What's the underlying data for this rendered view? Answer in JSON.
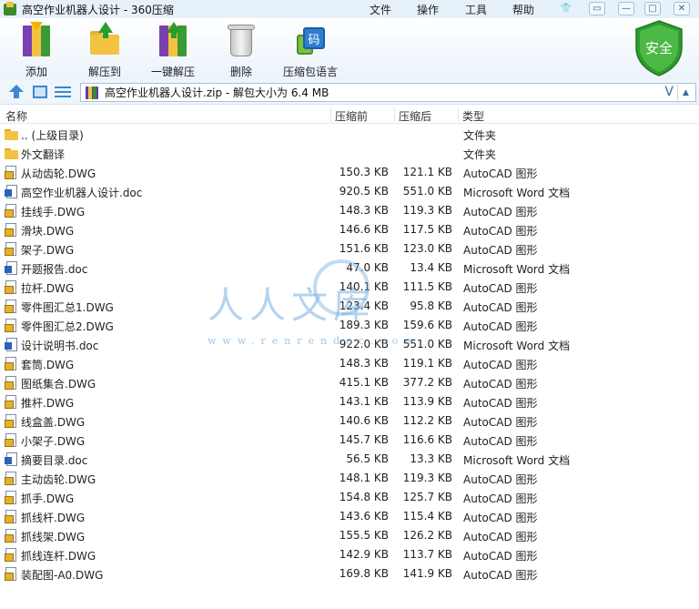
{
  "window": {
    "title": "高空作业机器人设计 - 360压缩",
    "menus": [
      "文件",
      "操作",
      "工具",
      "帮助"
    ],
    "controls": {
      "skin": "👕",
      "feedback": "▭",
      "minimize": "—",
      "maximize": "□",
      "close": "✕"
    }
  },
  "toolbar": {
    "add": "添加",
    "extract_to": "解压到",
    "one_click": "一键解压",
    "delete": "删除",
    "language": "压缩包语言",
    "language_glyph": "码"
  },
  "security": {
    "label": "安全",
    "color": "#3aa535"
  },
  "address": {
    "text": "高空作业机器人设计.zip - 解包大小为 6.4 MB",
    "dropdown": "V",
    "scroll": "▲"
  },
  "columns": {
    "name": "名称",
    "before": "压缩前",
    "after": "压缩后",
    "type": "类型"
  },
  "files": [
    {
      "name": ".. (上级目录)",
      "before": "",
      "after": "",
      "type": "文件夹",
      "kind": "folder"
    },
    {
      "name": "外文翻译",
      "before": "",
      "after": "",
      "type": "文件夹",
      "kind": "folder"
    },
    {
      "name": "从动齿轮.DWG",
      "before": "150.3 KB",
      "after": "121.1 KB",
      "type": "AutoCAD 图形",
      "kind": "dwg"
    },
    {
      "name": "高空作业机器人设计.doc",
      "before": "920.5 KB",
      "after": "551.0 KB",
      "type": "Microsoft Word 文档",
      "kind": "doc"
    },
    {
      "name": "挂线手.DWG",
      "before": "148.3 KB",
      "after": "119.3 KB",
      "type": "AutoCAD 图形",
      "kind": "dwg"
    },
    {
      "name": "滑块.DWG",
      "before": "146.6 KB",
      "after": "117.5 KB",
      "type": "AutoCAD 图形",
      "kind": "dwg"
    },
    {
      "name": "架子.DWG",
      "before": "151.6 KB",
      "after": "123.0 KB",
      "type": "AutoCAD 图形",
      "kind": "dwg"
    },
    {
      "name": "开题报告.doc",
      "before": "47.0 KB",
      "after": "13.4 KB",
      "type": "Microsoft Word 文档",
      "kind": "doc"
    },
    {
      "name": "拉杆.DWG",
      "before": "140.1 KB",
      "after": "111.5 KB",
      "type": "AutoCAD 图形",
      "kind": "dwg"
    },
    {
      "name": "零件图汇总1.DWG",
      "before": "123.4 KB",
      "after": "95.8 KB",
      "type": "AutoCAD 图形",
      "kind": "dwg"
    },
    {
      "name": "零件图汇总2.DWG",
      "before": "189.3 KB",
      "after": "159.6 KB",
      "type": "AutoCAD 图形",
      "kind": "dwg"
    },
    {
      "name": "设计说明书.doc",
      "before": "922.0 KB",
      "after": "551.0 KB",
      "type": "Microsoft Word 文档",
      "kind": "doc"
    },
    {
      "name": "套筒.DWG",
      "before": "148.3 KB",
      "after": "119.1 KB",
      "type": "AutoCAD 图形",
      "kind": "dwg"
    },
    {
      "name": "图纸集合.DWG",
      "before": "415.1 KB",
      "after": "377.2 KB",
      "type": "AutoCAD 图形",
      "kind": "dwg"
    },
    {
      "name": "推杆.DWG",
      "before": "143.1 KB",
      "after": "113.9 KB",
      "type": "AutoCAD 图形",
      "kind": "dwg"
    },
    {
      "name": "线盒盖.DWG",
      "before": "140.6 KB",
      "after": "112.2 KB",
      "type": "AutoCAD 图形",
      "kind": "dwg"
    },
    {
      "name": "小架子.DWG",
      "before": "145.7 KB",
      "after": "116.6 KB",
      "type": "AutoCAD 图形",
      "kind": "dwg"
    },
    {
      "name": "摘要目录.doc",
      "before": "56.5 KB",
      "after": "13.3 KB",
      "type": "Microsoft Word 文档",
      "kind": "doc"
    },
    {
      "name": "主动齿轮.DWG",
      "before": "148.1 KB",
      "after": "119.3 KB",
      "type": "AutoCAD 图形",
      "kind": "dwg"
    },
    {
      "name": "抓手.DWG",
      "before": "154.8 KB",
      "after": "125.7 KB",
      "type": "AutoCAD 图形",
      "kind": "dwg"
    },
    {
      "name": "抓线杆.DWG",
      "before": "143.6 KB",
      "after": "115.4 KB",
      "type": "AutoCAD 图形",
      "kind": "dwg"
    },
    {
      "name": "抓线架.DWG",
      "before": "155.5 KB",
      "after": "126.2 KB",
      "type": "AutoCAD 图形",
      "kind": "dwg"
    },
    {
      "name": "抓线连杆.DWG",
      "before": "142.9 KB",
      "after": "113.7 KB",
      "type": "AutoCAD 图形",
      "kind": "dwg"
    },
    {
      "name": "装配图-A0.DWG",
      "before": "169.8 KB",
      "after": "141.9 KB",
      "type": "AutoCAD 图形",
      "kind": "dwg"
    }
  ],
  "watermark": {
    "text": "人人文库",
    "url": "www.renrendoc.com"
  }
}
